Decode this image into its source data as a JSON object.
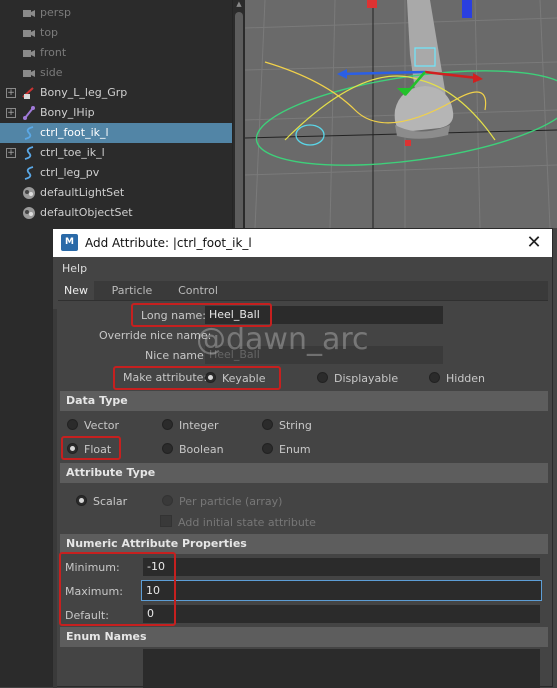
{
  "outliner": {
    "items": [
      {
        "label": "persp",
        "icon": "camera-icon",
        "dim": true,
        "expand": false,
        "selected": false
      },
      {
        "label": "top",
        "icon": "camera-icon",
        "dim": true,
        "expand": false,
        "selected": false
      },
      {
        "label": "front",
        "icon": "camera-icon",
        "dim": true,
        "expand": false,
        "selected": false
      },
      {
        "label": "side",
        "icon": "camera-icon",
        "dim": true,
        "expand": false,
        "selected": false
      },
      {
        "label": "Bony_L_leg_Grp",
        "icon": "group-icon",
        "dim": false,
        "expand": true,
        "selected": false
      },
      {
        "label": "Bony_lHip",
        "icon": "joint-icon",
        "dim": false,
        "expand": true,
        "selected": false
      },
      {
        "label": "ctrl_foot_ik_l",
        "icon": "curve-icon",
        "dim": false,
        "expand": false,
        "selected": true
      },
      {
        "label": "ctrl_toe_ik_l",
        "icon": "curve-icon",
        "dim": false,
        "expand": true,
        "selected": false
      },
      {
        "label": "ctrl_leg_pv",
        "icon": "curve-icon",
        "dim": false,
        "expand": false,
        "selected": false
      },
      {
        "label": "defaultLightSet",
        "icon": "set-icon",
        "dim": false,
        "expand": false,
        "selected": false
      },
      {
        "label": "defaultObjectSet",
        "icon": "set-icon",
        "dim": false,
        "expand": false,
        "selected": false
      }
    ]
  },
  "dialog": {
    "title": "Add Attribute: |ctrl_foot_ik_l",
    "app_icon_text": "M",
    "close_glyph": "✕",
    "menu": {
      "help": "Help"
    },
    "tabs": [
      "New",
      "Particle",
      "Control"
    ],
    "long_name_label": "Long name:",
    "long_name_value": "Heel_Ball",
    "override_label": "Override nice name:",
    "nice_name_label": "Nice name:",
    "nice_name_value": "Heel_Ball",
    "watermark": "@dawn_arc",
    "make_attr_label": "Make attribute:",
    "make_attr_options": [
      "Keyable",
      "Displayable",
      "Hidden"
    ],
    "data_type_header": "Data Type",
    "data_types": [
      "Vector",
      "Integer",
      "String",
      "Float",
      "Boolean",
      "Enum"
    ],
    "data_type_selected": "Float",
    "attr_type_header": "Attribute Type",
    "attr_type_scalar": "Scalar",
    "attr_type_per_particle": "Per particle (array)",
    "add_initial_state": "Add initial state attribute",
    "numeric_header": "Numeric Attribute Properties",
    "minimum_label": "Minimum:",
    "minimum_value": "-10",
    "maximum_label": "Maximum:",
    "maximum_value": "10",
    "default_label": "Default:",
    "default_value": "0",
    "enum_header": "Enum Names"
  },
  "colors": {
    "selection": "#5285a6",
    "highlight_box": "#c6201f",
    "focus_border": "#5d9ed6",
    "viewport_bg": "#6a6a6a"
  }
}
